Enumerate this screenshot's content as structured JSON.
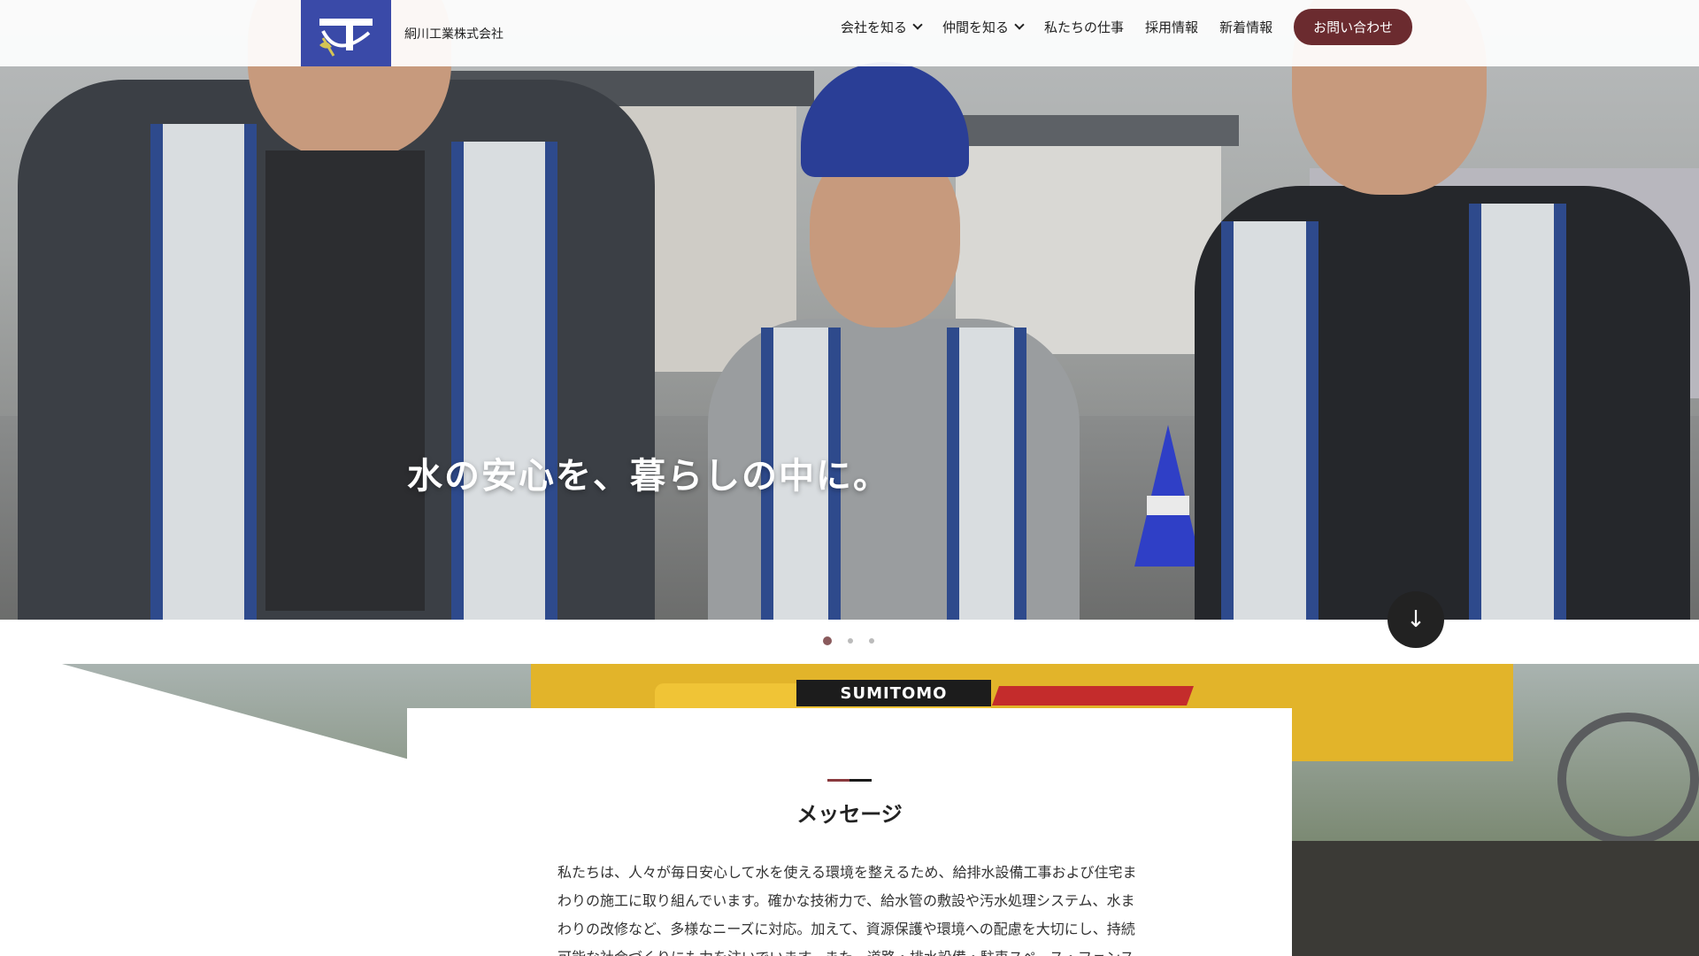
{
  "header": {
    "company_name": "絅川工業株式会社",
    "nav": [
      {
        "label": "会社を知る",
        "has_dropdown": true
      },
      {
        "label": "仲間を知る",
        "has_dropdown": true
      },
      {
        "label": "私たちの仕事",
        "has_dropdown": false
      },
      {
        "label": "採用情報",
        "has_dropdown": false
      },
      {
        "label": "新着情報",
        "has_dropdown": false
      }
    ],
    "contact_label": "お問い合わせ"
  },
  "hero": {
    "tagline": "水の安心を、暮らしの中に。",
    "scroll_icon": "arrow-down-icon",
    "slide_count": 3,
    "active_slide": 1
  },
  "photo": {
    "excavator_brand": "SUMITOMO"
  },
  "message": {
    "title": "メッセージ",
    "body": "私たちは、人々が毎日安心して水を使える環境を整えるため、給排水設備工事および住宅まわりの施工に取り組んでいます。確かな技術力で、給水管の敷設や汚水処理システム、水まわりの改修など、多様なニーズに対応。加えて、資源保護や環境への配慮を大切にし、持続可能な社会づくりにも力を注いでいます。また、道路・排水設備・駐車スペース・フェンス"
  },
  "colors": {
    "brand_blue": "#3a4aa8",
    "accent_maroon": "#6b2b2f",
    "text_dark": "#222222"
  }
}
